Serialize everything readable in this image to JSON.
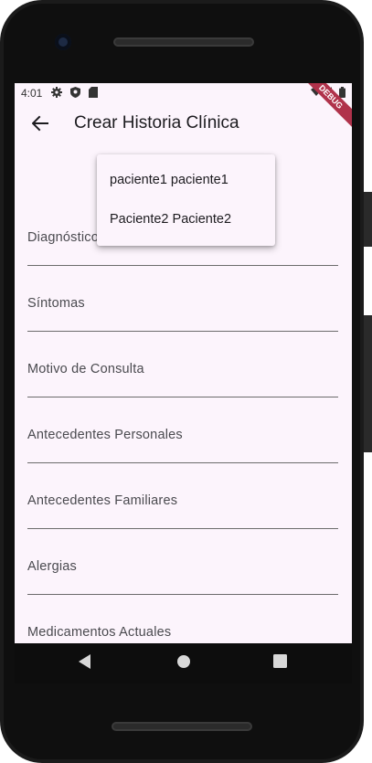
{
  "status_bar": {
    "time": "4:01",
    "icons": [
      "gear-icon",
      "shield-icon",
      "sd-card-icon"
    ],
    "right_icons": [
      "wifi-icon",
      "signal-icon",
      "battery-icon"
    ],
    "debug_banner": "DEBUG"
  },
  "app_bar": {
    "back_icon": "arrow-back-icon",
    "title": "Crear Historia Clínica"
  },
  "dropdown": {
    "options": [
      "paciente1 paciente1",
      "Paciente2 Paciente2"
    ]
  },
  "form": {
    "fields": [
      {
        "label": "Diagnóstico"
      },
      {
        "label": "Síntomas"
      },
      {
        "label": "Motivo de Consulta"
      },
      {
        "label": "Antecedentes Personales"
      },
      {
        "label": "Antecedentes Familiares"
      },
      {
        "label": "Alergias"
      },
      {
        "label": "Medicamentos Actuales"
      }
    ]
  },
  "nav_bar": {
    "icons": [
      "back-triangle-icon",
      "home-circle-icon",
      "recents-square-icon"
    ]
  },
  "colors": {
    "screen_bg": "#fcf4fc",
    "debug_ribbon": "#b0324b",
    "underline": "#6b6b6b"
  }
}
